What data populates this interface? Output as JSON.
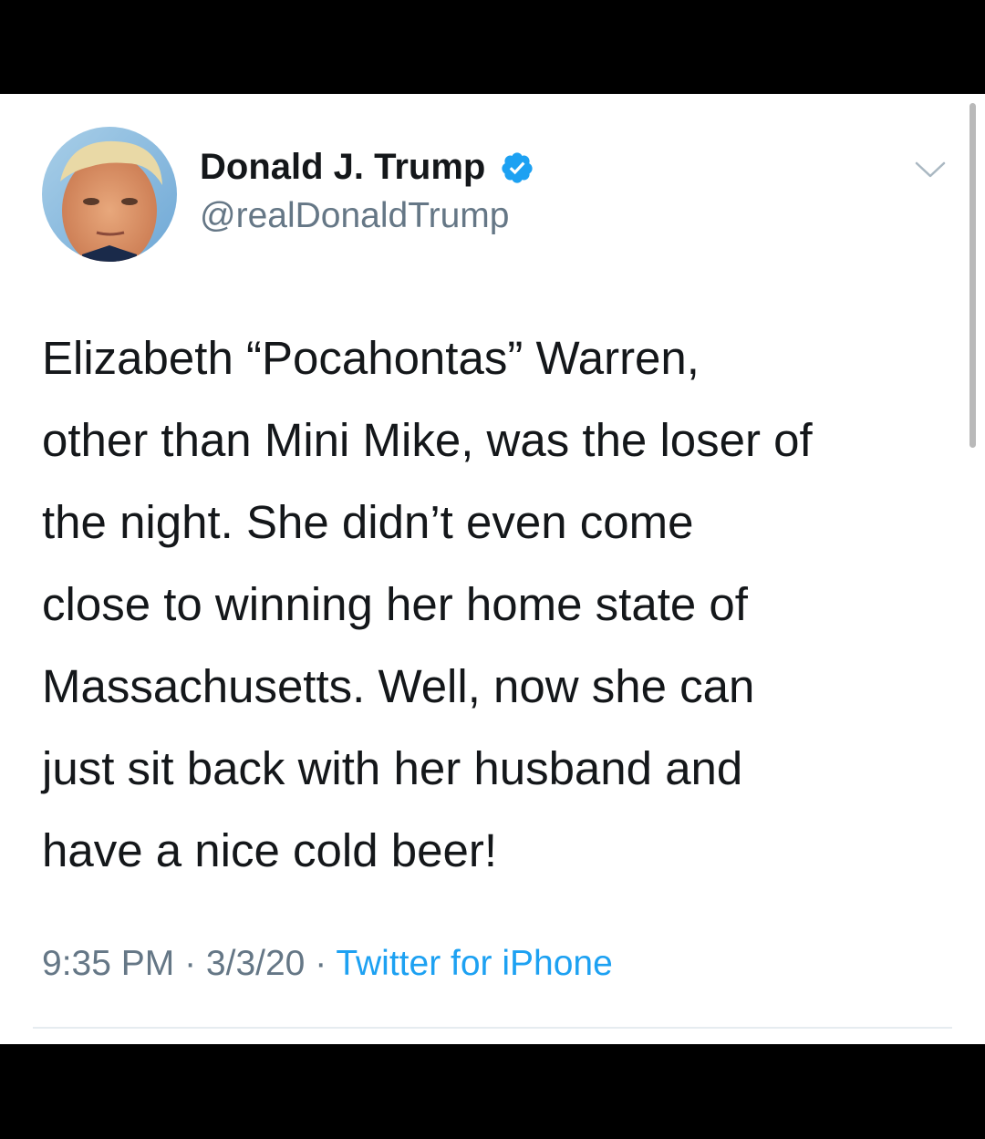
{
  "tweet": {
    "display_name": "Donald J. Trump",
    "handle": "@realDonaldTrump",
    "text": "Elizabeth “Pocahontas” Warren,\nother than Mini Mike, was the loser of\nthe night. She didn’t even come\nclose to winning her home state of\nMassachusetts. Well, now she can\njust sit back with her husband and\nhave a nice cold beer!",
    "time": "9:35 PM",
    "separator": "·",
    "date": "3/3/20",
    "source": "Twitter for iPhone",
    "verified_icon": "verified-badge-icon",
    "menu_icon": "chevron-down-icon"
  },
  "colors": {
    "name": "#14171a",
    "secondary": "#657786",
    "link": "#1da1f2",
    "verified": "#1da1f2"
  }
}
